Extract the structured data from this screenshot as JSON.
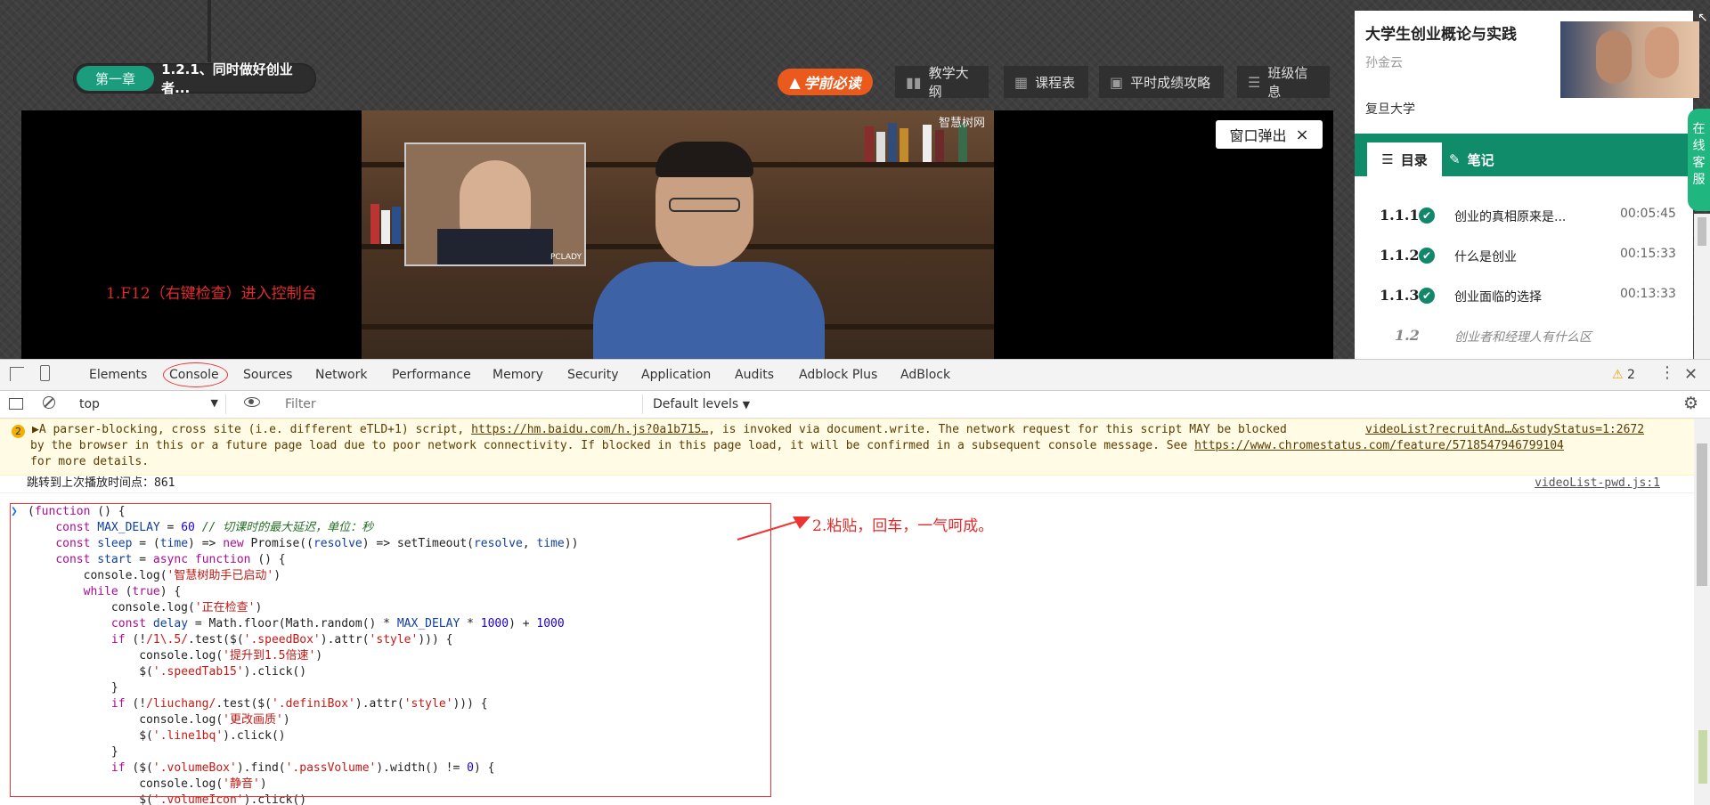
{
  "page": {
    "chapter_tag": "第一章",
    "chapter_title": "1.2.1、同时做好创业者...",
    "xueqian_logo": "学前必读",
    "top_buttons": [
      {
        "label": "教学大纲",
        "icon": "book-icon"
      },
      {
        "label": "课程表",
        "icon": "grid-icon"
      },
      {
        "label": "平时成绩攻略",
        "icon": "video-icon"
      },
      {
        "label": "班级信息",
        "icon": "list-icon"
      }
    ],
    "video_watermark": "智慧树网",
    "inset_watermark": "PCLADY",
    "annotation_1": "1.F12（右键检查）进入控制台",
    "popup_button": "窗口弹出",
    "popup_close": "×"
  },
  "course": {
    "title": "大学生创业概论与实践",
    "teacher": "孙金云",
    "school": "复旦大学",
    "tab_toc": "目录",
    "tab_notes": "笔记",
    "toc": [
      {
        "num": "1.1.1",
        "title": "创业的真相原来是...",
        "time": "00:05:45",
        "done": true
      },
      {
        "num": "1.1.2",
        "title": "什么是创业",
        "time": "00:15:33",
        "done": true
      },
      {
        "num": "1.1.3",
        "title": "创业面临的选择",
        "time": "00:13:33",
        "done": true
      },
      {
        "num": "1.2",
        "title": "创业者和经理人有什么区",
        "time": "",
        "done": false
      }
    ],
    "service_label": "在线客服"
  },
  "devtools": {
    "tabs": [
      "Elements",
      "Console",
      "Sources",
      "Network",
      "Performance",
      "Memory",
      "Security",
      "Application",
      "Audits",
      "Adblock Plus",
      "AdBlock"
    ],
    "warning_count": "2",
    "context": "top",
    "filter_placeholder": "Filter",
    "levels": "Default levels",
    "warning": {
      "badge": "2",
      "line1_pre": "▶A parser-blocking, cross site (i.e. different eTLD+1) script, ",
      "line1_link": "https://hm.baidu.com/h.js?0a1b715…",
      "line1_post": ", is invoked via document.write. The network request for this script MAY be blocked",
      "line1_src": "videoList?recruitAnd…&studyStatus=1:2672",
      "line2_pre": "by the browser in this or a future page load due to poor network connectivity. If blocked in this page load, it will be confirmed in a subsequent console message. See ",
      "line2_link": "https://www.chromestatus.com/feature/5718547946799104",
      "line3": "for more details."
    },
    "log": {
      "text": "跳转到上次播放时间点：861",
      "src": "videoList-pwd.js:1"
    },
    "annotation_2": "2.粘贴，回车，一气呵成。"
  }
}
